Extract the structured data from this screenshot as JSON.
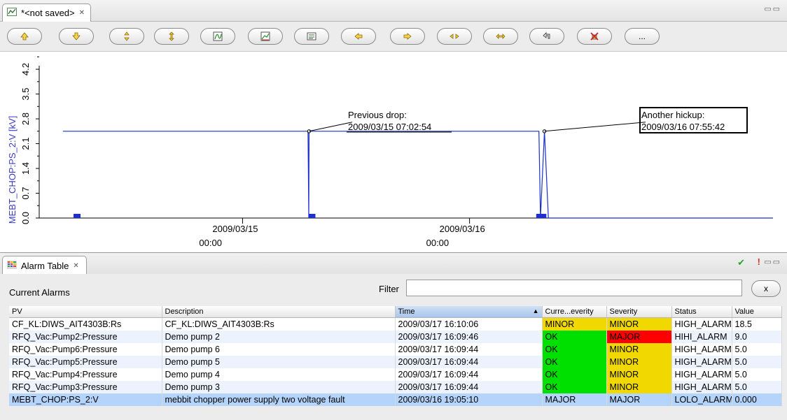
{
  "editor": {
    "tab_title": "*<not saved>",
    "close_glyph": "✕",
    "window_controls": "▭▭"
  },
  "toolbar": {
    "buttons": [
      {
        "name": "move-up-button",
        "icon": "arrow-up-icon"
      },
      {
        "name": "move-down-button",
        "icon": "arrow-down-icon"
      },
      {
        "name": "zoom-in-y-button",
        "icon": "zoom-in-y-icon"
      },
      {
        "name": "zoom-out-y-button",
        "icon": "zoom-out-y-icon"
      },
      {
        "name": "autoscale-button",
        "icon": "autoscale-icon"
      },
      {
        "name": "stagger-button",
        "icon": "stagger-icon"
      },
      {
        "name": "legend-button",
        "icon": "legend-icon"
      },
      {
        "name": "scroll-left-button",
        "icon": "arrow-left-icon"
      },
      {
        "name": "scroll-right-button",
        "icon": "arrow-right-icon"
      },
      {
        "name": "zoom-in-x-button",
        "icon": "zoom-in-x-icon"
      },
      {
        "name": "zoom-out-x-button",
        "icon": "zoom-out-x-icon"
      },
      {
        "name": "undo-button",
        "icon": "undo-icon"
      },
      {
        "name": "remove-markers-button",
        "icon": "remove-markers-icon"
      },
      {
        "name": "more-button",
        "icon": "ellipsis-icon",
        "label": "..."
      }
    ]
  },
  "chart_data": {
    "type": "line",
    "ylabel": "MEBT_CHOP:PS_2:V [kV]",
    "y_ticks": [
      "0.0",
      "0.7",
      "1.4",
      "2.1",
      "2.8",
      "3.5",
      "4.2"
    ],
    "ylim": [
      0,
      4.3
    ],
    "x_ticks": [
      {
        "date": "2009/03/15",
        "time": "00:00"
      },
      {
        "date": "2009/03/16",
        "time": "00:00"
      }
    ],
    "series": [
      {
        "values_note_free": true,
        "x": [
          "2009/03/14 05:00",
          "2009/03/15 06:55",
          "2009/03/15 07:00",
          "2009/03/15 07:02",
          "2009/03/15 07:20",
          "2009/03/15 08:30",
          "2009/03/16 07:20",
          "2009/03/16 07:30",
          "2009/03/16 07:55",
          "2009/03/16 08:20",
          "2009/03/17 08:00"
        ],
        "y": [
          2.45,
          2.45,
          0.0,
          2.45,
          2.45,
          2.45,
          2.45,
          0.0,
          2.45,
          0.0,
          0.0
        ]
      }
    ],
    "annotations": [
      {
        "text": "Previous drop:",
        "value": "2009/03/15 07:02:54"
      },
      {
        "text": "Another hickup:",
        "value": "2009/03/16 07:55:42"
      }
    ],
    "series_color": "#1d2fcc"
  },
  "alarm_view": {
    "tab_title": "Alarm Table",
    "close_glyph": "✕",
    "header_icons": {
      "ack": "✔",
      "alert": "!",
      "window": "▭▭"
    },
    "title": "Current Alarms",
    "filter_label": "Filter",
    "filter_value": "",
    "clear_label": "x",
    "columns": [
      "PV",
      "Description",
      "Time",
      "Curre...everity",
      "Severity",
      "Status",
      "Value"
    ],
    "sort_indicator": "▲",
    "rows": [
      {
        "pv": "CF_KL:DIWS_AIT4303B:Rs",
        "desc": "CF_KL:DIWS_AIT4303B:Rs",
        "time": "2009/03/17 16:10:06",
        "cur": "MINOR",
        "sev": "MINOR",
        "status": "HIGH_ALARM",
        "value": "18.5"
      },
      {
        "pv": "RFQ_Vac:Pump2:Pressure",
        "desc": "Demo pump 2",
        "time": "2009/03/17 16:09:46",
        "cur": "OK",
        "sev": "MAJOR",
        "status": "HIHI_ALARM",
        "value": "9.0"
      },
      {
        "pv": "RFQ_Vac:Pump6:Pressure",
        "desc": "Demo pump 6",
        "time": "2009/03/17 16:09:44",
        "cur": "OK",
        "sev": "MINOR",
        "status": "HIGH_ALARM",
        "value": "5.0"
      },
      {
        "pv": "RFQ_Vac:Pump5:Pressure",
        "desc": "Demo pump 5",
        "time": "2009/03/17 16:09:44",
        "cur": "OK",
        "sev": "MINOR",
        "status": "HIGH_ALARM",
        "value": "5.0"
      },
      {
        "pv": "RFQ_Vac:Pump4:Pressure",
        "desc": "Demo pump 4",
        "time": "2009/03/17 16:09:44",
        "cur": "OK",
        "sev": "MINOR",
        "status": "HIGH_ALARM",
        "value": "5.0"
      },
      {
        "pv": "RFQ_Vac:Pump3:Pressure",
        "desc": "Demo pump 3",
        "time": "2009/03/17 16:09:44",
        "cur": "OK",
        "sev": "MINOR",
        "status": "HIGH_ALARM",
        "value": "5.0"
      },
      {
        "pv": "MEBT_CHOP:PS_2:V",
        "desc": "mebbit chopper power supply two voltage fault",
        "time": "2009/03/16 19:05:10",
        "cur": "MAJOR",
        "sev": "MAJOR",
        "status": "LOLO_ALARM",
        "value": "0.000"
      }
    ]
  },
  "colors": {
    "minor": "#f0d800",
    "major": "#ff0000",
    "ok": "#00e000",
    "selected": "#b5d4fb"
  }
}
